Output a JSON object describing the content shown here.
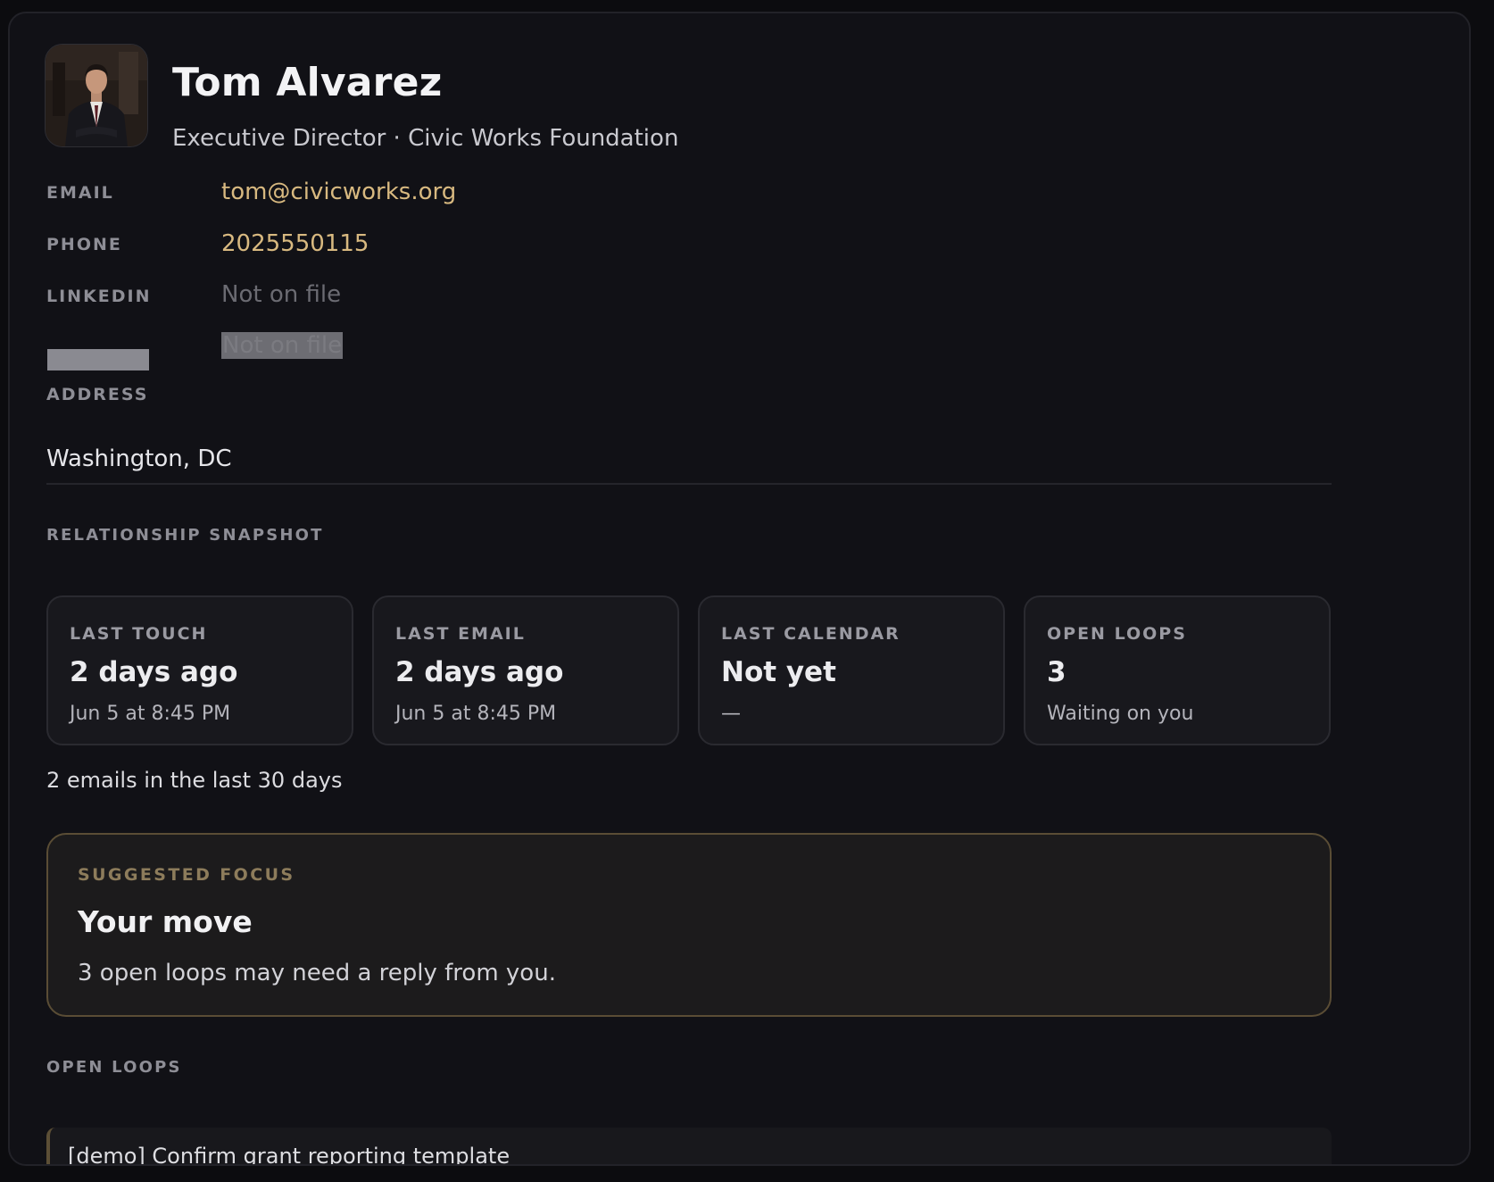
{
  "contact": {
    "name": "Tom Alvarez",
    "subtitle": "Executive Director · Civic Works Foundation"
  },
  "details": {
    "email_label": "EMAIL",
    "email_value": "tom@civicworks.org",
    "phone_label": "PHONE",
    "phone_value": "2025550115",
    "linkedin_label": "LINKEDIN",
    "linkedin_value": "Not on file",
    "hidden_value": "Not on file",
    "address_label": "ADDRESS",
    "address_value": "Washington, DC"
  },
  "snapshot": {
    "title": "RELATIONSHIP SNAPSHOT",
    "cards": [
      {
        "label": "LAST TOUCH",
        "value": "2 days ago",
        "sub": "Jun 5 at 8:45 PM"
      },
      {
        "label": "LAST EMAIL",
        "value": "2 days ago",
        "sub": "Jun 5 at 8:45 PM"
      },
      {
        "label": "LAST CALENDAR",
        "value": "Not yet",
        "sub": "—"
      },
      {
        "label": "OPEN LOOPS",
        "value": "3",
        "sub": "Waiting on you"
      }
    ],
    "emails_note": "2 emails in the last 30 days"
  },
  "focus": {
    "label": "SUGGESTED FOCUS",
    "title": "Your move",
    "text": "3 open loops may need a reply from you."
  },
  "open_loops": {
    "title": "OPEN LOOPS",
    "items": [
      {
        "text": "[demo] Confirm grant reporting template"
      }
    ]
  },
  "colors": {
    "background": "#111116",
    "accent_gold": "#d8b980",
    "focus_border": "#5a4d35"
  }
}
